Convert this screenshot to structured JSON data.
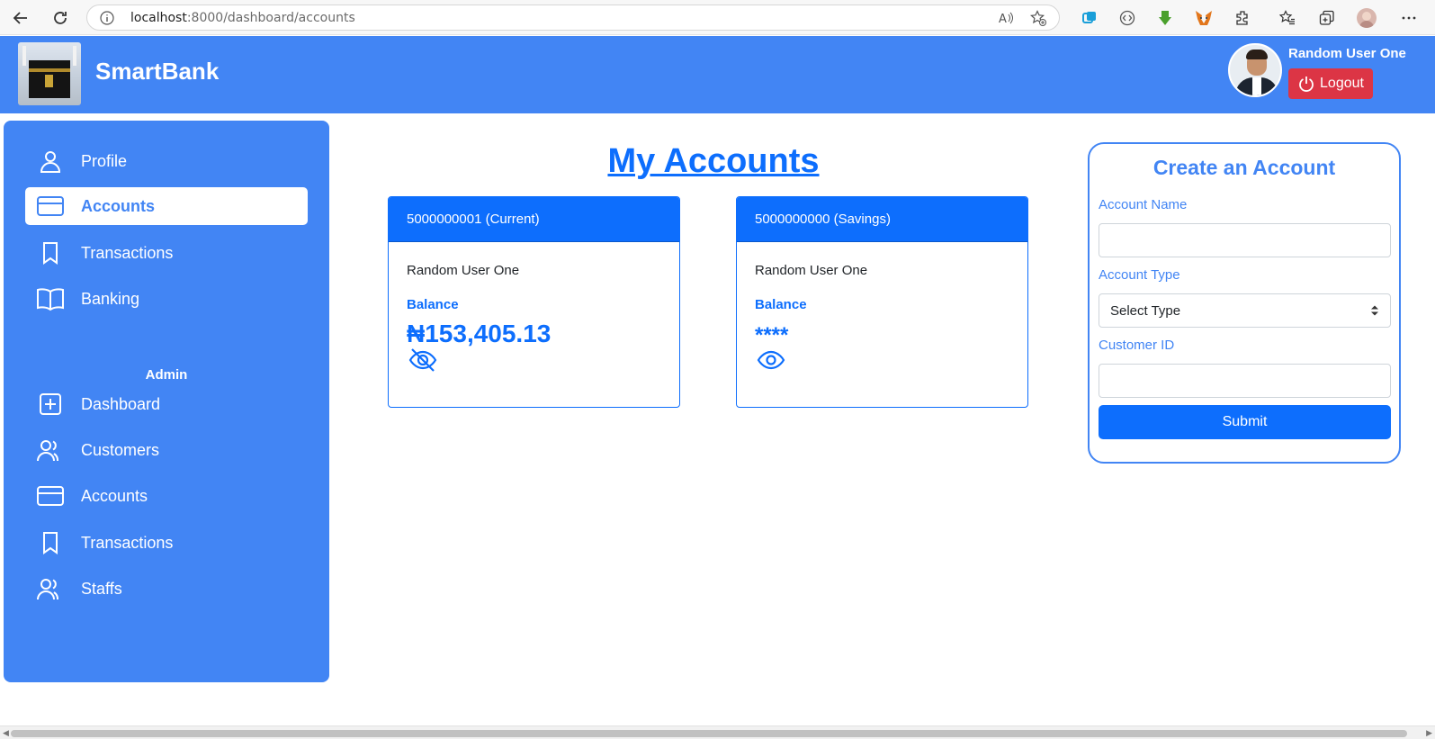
{
  "browser": {
    "url_host": "localhost",
    "url_rest": ":8000/dashboard/accounts"
  },
  "header": {
    "brand": "SmartBank",
    "user_name": "Random User One",
    "logout_label": "Logout"
  },
  "sidebar": {
    "items": [
      {
        "label": "Profile",
        "icon": "user-icon"
      },
      {
        "label": "Accounts",
        "icon": "card-icon",
        "active": true
      },
      {
        "label": "Transactions",
        "icon": "bookmark-icon"
      },
      {
        "label": "Banking",
        "icon": "book-icon"
      }
    ],
    "admin_title": "Admin",
    "admin_items": [
      {
        "label": "Dashboard",
        "icon": "plus-square-icon"
      },
      {
        "label": "Customers",
        "icon": "users-icon"
      },
      {
        "label": "Accounts",
        "icon": "card-icon"
      },
      {
        "label": "Transactions",
        "icon": "bookmark-icon"
      },
      {
        "label": "Staffs",
        "icon": "users-icon"
      }
    ]
  },
  "main": {
    "title": "My Accounts",
    "accounts": [
      {
        "header": "5000000001 (Current)",
        "owner": "Random User One",
        "balance_label": "Balance",
        "balance": "₦153,405.13",
        "visibility_icon": "eye-off-icon"
      },
      {
        "header": "5000000000 (Savings)",
        "owner": "Random User One",
        "balance_label": "Balance",
        "balance": "****",
        "visibility_icon": "eye-icon"
      }
    ]
  },
  "create_form": {
    "title": "Create an Account",
    "account_name_label": "Account Name",
    "account_name_value": "",
    "account_type_label": "Account Type",
    "account_type_selected": "Select Type",
    "customer_id_label": "Customer ID",
    "customer_id_value": "",
    "submit_label": "Submit"
  },
  "colors": {
    "primary": "#4285f4",
    "card_blue": "#0d6efd",
    "danger": "#dc3545"
  }
}
